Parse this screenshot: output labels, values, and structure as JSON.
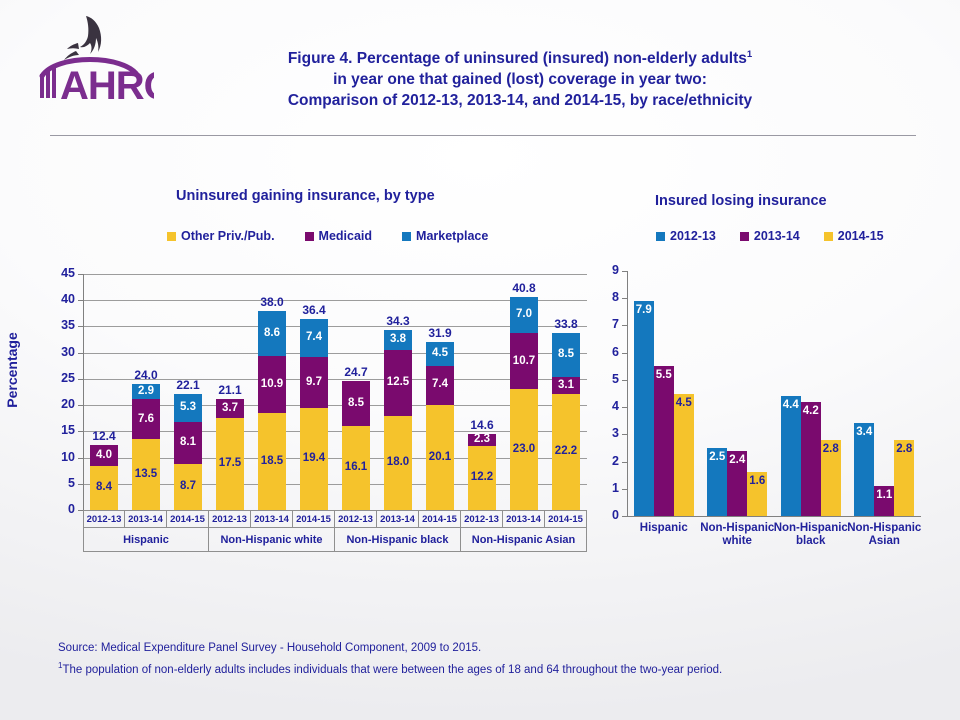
{
  "logo": {
    "name": "ahrq-logo",
    "wordmark": "AHRQ",
    "color": "#7B2D8E"
  },
  "title": {
    "line1": "Figure 4. Percentage of uninsured (insured) non-elderly adults",
    "line1_sup": "1",
    "line2": "in year one that gained (lost) coverage in year two:",
    "line3": "Comparison of 2012-13, 2013-14, and 2014-15, by race/ethnicity"
  },
  "colors": {
    "gold": "#F5C32C",
    "purple": "#7A0A6E",
    "blue": "#1478BE",
    "title_blue": "#21219C",
    "gridline": "#9C9C9C",
    "divider": "#9A99A3"
  },
  "footnotes": {
    "source": "Source:  Medical Expenditure Panel Survey  - Household Component, 2009 to 2015.",
    "note_sup": "1",
    "note": "The population of non-elderly adults includes individuals that were between the ages of 18 and 64 throughout the two-year period."
  },
  "chart_data": [
    {
      "id": "uninsured-gaining",
      "type": "bar",
      "stacked": true,
      "title": "Uninsured gaining insurance, by type",
      "xlabel": "",
      "ylabel": "Percentage",
      "ylim": [
        0,
        45
      ],
      "ytick_step": 5,
      "yticks": [
        "0",
        "5",
        "10",
        "15",
        "20",
        "25",
        "30",
        "35",
        "40",
        "45"
      ],
      "grid": true,
      "legend_position": "top",
      "categories": [
        "2012-13",
        "2013-14",
        "2014-15",
        "2012-13",
        "2013-14",
        "2014-15",
        "2012-13",
        "2013-14",
        "2014-15",
        "2012-13",
        "2013-14",
        "2014-15"
      ],
      "groups": [
        {
          "label": "Hispanic",
          "span": 3
        },
        {
          "label": "Non-Hispanic white",
          "span": 3
        },
        {
          "label": "Non-Hispanic black",
          "span": 3
        },
        {
          "label": "Non-Hispanic Asian",
          "span": 3
        }
      ],
      "series": [
        {
          "name": "Other Priv./Pub.",
          "color": "#F5C32C",
          "values": [
            8.4,
            13.5,
            8.7,
            17.5,
            18.5,
            19.4,
            16.1,
            18.0,
            20.1,
            12.2,
            23.0,
            22.2
          ]
        },
        {
          "name": "Medicaid",
          "color": "#7A0A6E",
          "values": [
            4.0,
            7.6,
            8.1,
            3.7,
            10.9,
            9.7,
            8.5,
            12.5,
            7.4,
            2.3,
            10.7,
            3.1
          ]
        },
        {
          "name": "Marketplace",
          "color": "#1478BE",
          "values": [
            null,
            2.9,
            5.3,
            null,
            8.6,
            7.4,
            null,
            3.8,
            4.5,
            null,
            7.0,
            8.5
          ]
        }
      ],
      "totals": [
        12.4,
        24.0,
        22.1,
        21.1,
        38.0,
        36.4,
        24.7,
        34.3,
        31.9,
        14.6,
        40.8,
        33.8
      ]
    },
    {
      "id": "insured-losing",
      "type": "bar",
      "stacked": false,
      "title": "Insured losing insurance",
      "xlabel": "",
      "ylabel": "",
      "ylim": [
        0,
        9
      ],
      "ytick_step": 1,
      "yticks": [
        "0",
        "1",
        "2",
        "3",
        "4",
        "5",
        "6",
        "7",
        "8",
        "9"
      ],
      "grid": false,
      "legend_position": "top",
      "categories": [
        "Hispanic",
        "Non-Hispanic white",
        "Non-Hispanic black",
        "Non-Hispanic Asian"
      ],
      "series": [
        {
          "name": "2012-13",
          "color": "#1478BE",
          "values": [
            7.9,
            2.5,
            4.4,
            3.4
          ]
        },
        {
          "name": "2013-14",
          "color": "#7A0A6E",
          "values": [
            5.5,
            2.4,
            4.2,
            1.1
          ]
        },
        {
          "name": "2014-15",
          "color": "#F5C32C",
          "values": [
            4.5,
            1.6,
            2.8,
            2.8
          ]
        }
      ]
    }
  ]
}
